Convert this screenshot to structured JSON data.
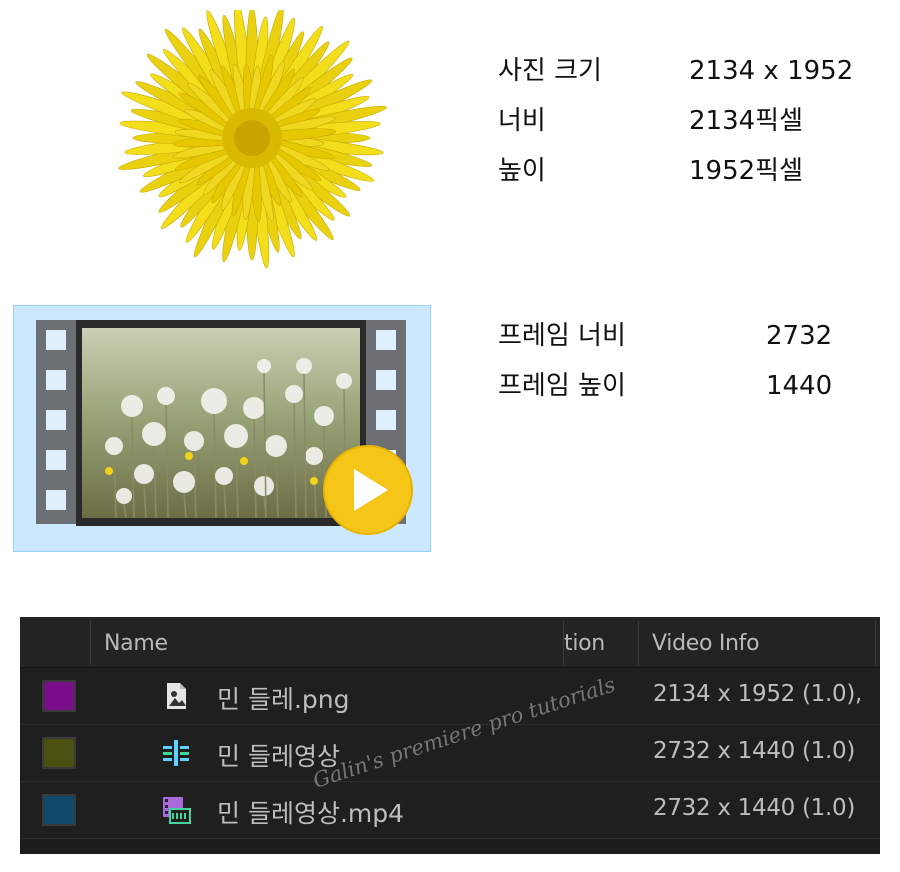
{
  "photo_info": {
    "rows": [
      {
        "label": "사진 크기",
        "value": "2134 x 1952"
      },
      {
        "label": "너비",
        "value": "2134픽셀"
      },
      {
        "label": "높이",
        "value": "1952픽셀"
      }
    ]
  },
  "frame_info": {
    "rows": [
      {
        "label": "프레임 너비",
        "value": "2732"
      },
      {
        "label": "프레임 높이",
        "value": "1440"
      }
    ]
  },
  "video_thumb": {
    "icon": "play-icon",
    "accent": "#f5c518"
  },
  "project_panel": {
    "columns": {
      "name": "Name",
      "duration": "tion",
      "video_info": "Video Info"
    },
    "items": [
      {
        "name": "민 들레.png",
        "video_info": "2134 x 1952 (1.0),",
        "color": "#7a0f8a",
        "icon": "image-file-icon"
      },
      {
        "name": "민 들레영상",
        "video_info": "2732 x 1440 (1.0)",
        "color": "#4a5010",
        "icon": "sequence-icon"
      },
      {
        "name": "민 들레영상.mp4",
        "video_info": "2732 x 1440 (1.0)",
        "color": "#0f4a6a",
        "icon": "video-file-icon"
      }
    ]
  },
  "watermark": "Galin's premiere pro tutorials"
}
